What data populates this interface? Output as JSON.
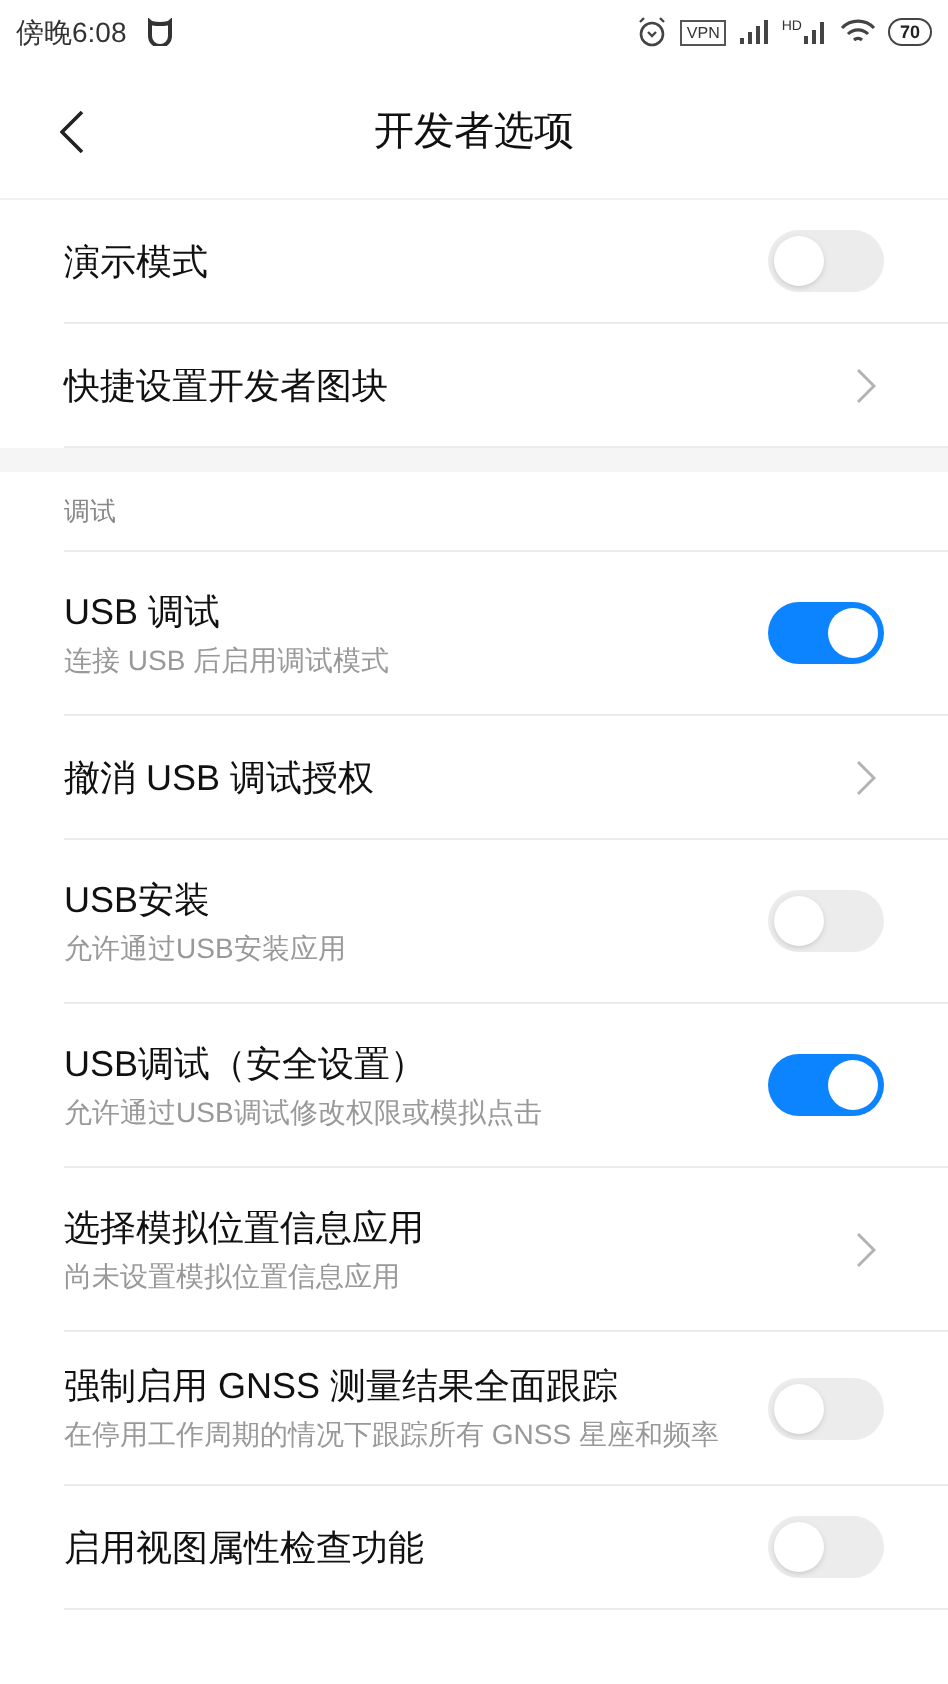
{
  "status_bar": {
    "time": "傍晚6:08",
    "vpn": "VPN",
    "hd": "HD",
    "battery": "70"
  },
  "header": {
    "title": "开发者选项"
  },
  "groups": [
    {
      "items": [
        {
          "kind": "toggle",
          "title": "演示模式",
          "on": false
        },
        {
          "kind": "link",
          "title": "快捷设置开发者图块"
        }
      ]
    },
    {
      "label": "调试",
      "items": [
        {
          "kind": "toggle",
          "title": "USB 调试",
          "subtitle": "连接 USB 后启用调试模式",
          "on": true
        },
        {
          "kind": "link",
          "title": "撤消 USB 调试授权"
        },
        {
          "kind": "toggle",
          "title": "USB安装",
          "subtitle": "允许通过USB安装应用",
          "on": false
        },
        {
          "kind": "toggle",
          "title": "USB调试（安全设置）",
          "subtitle": "允许通过USB调试修改权限或模拟点击",
          "on": true
        },
        {
          "kind": "link",
          "title": "选择模拟位置信息应用",
          "subtitle": "尚未设置模拟位置信息应用"
        },
        {
          "kind": "toggle",
          "title": "强制启用 GNSS 测量结果全面跟踪",
          "subtitle": "在停用工作周期的情况下跟踪所有 GNSS 星座和频率",
          "on": false
        },
        {
          "kind": "toggle",
          "title": "启用视图属性检查功能",
          "on": false
        }
      ]
    }
  ]
}
